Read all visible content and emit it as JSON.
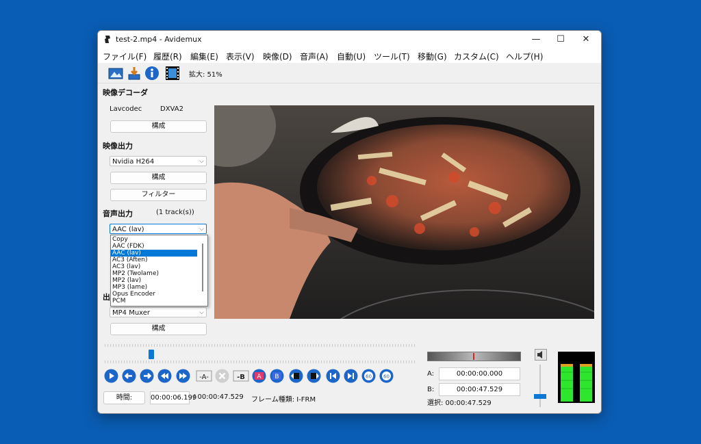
{
  "window": {
    "title": "test-2.mp4 - Avidemux",
    "minimize": "—",
    "maximize": "☐",
    "close": "✕"
  },
  "menu": [
    "ファイル(F)",
    "履歴(R)",
    "編集(E)",
    "表示(V)",
    "映像(D)",
    "音声(A)",
    "自動(U)",
    "ツール(T)",
    "移動(G)",
    "カスタム(C)",
    "ヘルプ(H)"
  ],
  "toolbar": {
    "zoom_label": "拡大: 51%"
  },
  "video_decoder": {
    "heading": "映像デコーダ",
    "decoder": "Lavcodec",
    "hw": "DXVA2",
    "config_label": "構成"
  },
  "video_output": {
    "heading": "映像出力",
    "codec": "Nvidia H264",
    "config_label": "構成",
    "filter_label": "フィルター"
  },
  "audio_output": {
    "heading": "音声出力",
    "tracks": "(1 track(s))",
    "codec": "AAC (lav)",
    "options": [
      "Copy",
      "AAC (FDK)",
      "AAC (lav)",
      "AC3 (Aften)",
      "AC3 (lav)",
      "MP2 (Twolame)",
      "MP2 (lav)",
      "MP3 (lame)",
      "Opus Encoder",
      "PCM"
    ],
    "selected_index": 2
  },
  "output_format": {
    "heading_partial": "出",
    "muxer": "MP4 Muxer",
    "config_label": "構成"
  },
  "timeline": {
    "position_fraction": 0.14
  },
  "controls": [
    "play",
    "prev-frame",
    "next-frame",
    "rewind",
    "fast-forward",
    "set-marker-a",
    "delete",
    "set-marker-b",
    "goto-marker-a",
    "goto-marker-b",
    "prev-black",
    "next-black",
    "first-frame",
    "last-frame",
    "back-60",
    "forward-60"
  ],
  "status": {
    "time_button": "時間:",
    "current_time": "00:00:06.199",
    "total_time": "/ 00:00:47.529",
    "frame_type": "フレーム種類: I-FRM"
  },
  "selection": {
    "a_label": "A:",
    "a_time": "00:00:00.000",
    "b_label": "B:",
    "b_time": "00:00:47.529",
    "sel_text": "選択: 00:00:47.529"
  },
  "volume": {
    "level_fraction": 0.3
  },
  "colors": {
    "accent": "#0078d7",
    "desktop": "#0a5db4",
    "vu_green": "#2ee62e"
  }
}
